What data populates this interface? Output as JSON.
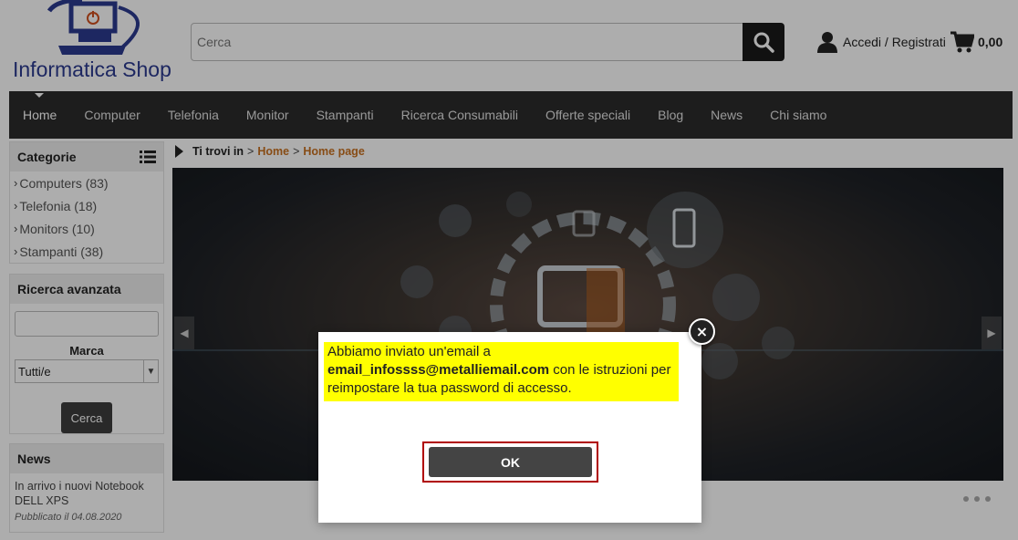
{
  "header": {
    "logo_text": "Informatica Shop",
    "search_placeholder": "Cerca",
    "account_label": "Accedi / Registrati",
    "cart_total": "0,00"
  },
  "nav": {
    "items": [
      "Home",
      "Computer",
      "Telefonia",
      "Monitor",
      "Stampanti",
      "Ricerca Consumabili",
      "Offerte speciali",
      "Blog",
      "News",
      "Chi siamo"
    ]
  },
  "sidebar": {
    "categories_title": "Categorie",
    "categories": [
      {
        "label": "Computers (83)"
      },
      {
        "label": "Telefonia (18)"
      },
      {
        "label": "Monitors (10)"
      },
      {
        "label": "Stampanti (38)"
      }
    ],
    "advanced_search_title": "Ricerca avanzata",
    "brand_label": "Marca",
    "brand_selected": "Tutti/e",
    "search_button": "Cerca",
    "news_title": "News",
    "news_item": "In arrivo i nuovi Notebook DELL XPS",
    "news_date": "Pubblicato il 04.08.2020"
  },
  "breadcrumb": {
    "prefix": "Ti trovi in",
    "sep": ">",
    "items": [
      "Home",
      "Home page"
    ]
  },
  "modal": {
    "message_before": "Abbiamo inviato un'email a",
    "email": "email_infossss@metalliemail.com",
    "message_after": "con le istruzioni per reimpostare la tua password di accesso.",
    "ok_label": "OK",
    "close_symbol": "×"
  },
  "colors": {
    "nav_bg": "#2b2b2b",
    "accent_link": "#c87020",
    "highlight": "#ffff00",
    "ok_frame": "#b00000",
    "logo": "#2b3a8f"
  }
}
